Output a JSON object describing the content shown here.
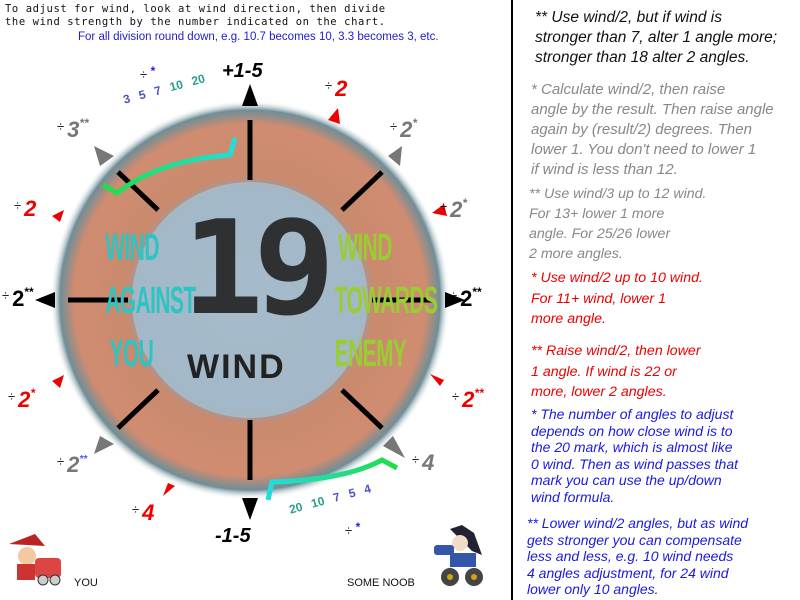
{
  "intro": {
    "line1": "To adjust for wind, look at wind direction, then divide\nthe wind strength by the number indicated on the chart.",
    "line2": "For all division round down, e.g. 10.7 becomes 10, 3.3 becomes 3, etc."
  },
  "dial": {
    "wind_value": "19",
    "wind_label": "WIND",
    "left_label": "WIND AGAINST YOU",
    "right_label": "WIND TOWARDS ENEMY",
    "top_label": "+1-5",
    "bottom_label": "-1-5",
    "upper_scale": [
      "3",
      "5",
      "7",
      "10",
      "20"
    ],
    "lower_scale": [
      "20",
      "10",
      "7",
      "5",
      "4"
    ],
    "divider_symbol": "÷",
    "markers": [
      {
        "position": "top-left-upper",
        "value": "",
        "mark": "*",
        "color": "#1a1ae0"
      },
      {
        "position": "top-left",
        "value": "3",
        "mark": "**",
        "color": "#777777"
      },
      {
        "position": "top-right-upper",
        "value": "2",
        "mark": "",
        "color": "#ee0000"
      },
      {
        "position": "top-right",
        "value": "2",
        "mark": "*",
        "color": "#777777"
      },
      {
        "position": "right-upper",
        "value": "2",
        "mark": "*",
        "color": "#777777"
      },
      {
        "position": "left-upper",
        "value": "2",
        "mark": "",
        "color": "#ee0000"
      },
      {
        "position": "left",
        "value": "2",
        "mark": "**",
        "color": "#000000"
      },
      {
        "position": "right",
        "value": "2",
        "mark": "**",
        "color": "#000000"
      },
      {
        "position": "left-lower",
        "value": "2",
        "mark": "*",
        "color": "#ee0000"
      },
      {
        "position": "right-lower",
        "value": "2",
        "mark": "**",
        "color": "#ee0000"
      },
      {
        "position": "bottom-left",
        "value": "2",
        "mark": "**",
        "color": "#777777"
      },
      {
        "position": "bottom-right",
        "value": "4",
        "mark": "",
        "color": "#777777"
      },
      {
        "position": "bottom-left-lower",
        "value": "4",
        "mark": "",
        "color": "#ee0000"
      },
      {
        "position": "bottom-right-lower",
        "value": "",
        "mark": "*",
        "color": "#1a1ae0"
      }
    ]
  },
  "players": {
    "you": "YOU",
    "enemy": "SOME NOOB"
  },
  "notes": [
    "** Use wind/2, but if wind is\nstronger than 7, alter 1 angle more;\nstronger than 18 alter 2 angles.",
    "* Calculate wind/2, then raise\nangle by the result. Then raise angle\nagain by (result/2) degrees. Then\nlower 1.  You don't need to lower 1\nif wind is less than 12.",
    "** Use wind/3 up to 12 wind.\n    For 13+ lower 1 more\n    angle.  For 25/26 lower\n    2 more angles.",
    "*  Use wind/2 up to 10 wind.\n    For 11+ wind, lower 1\n    more angle.",
    "** Raise wind/2, then lower\n    1 angle.  If wind is 22 or\n    more, lower 2 angles.",
    "*  The number of angles to adjust\ndepends on how close wind is to\nthe 20 mark, which is almost like\n0 wind.  Then as wind passes that\nmark you can use the up/down\nwind formula.",
    "** Lower wind/2 angles, but as wind\ngets stronger you can compensate\nless and less, e.g. 10 wind needs\n4 angles adjustment, for 24 wind\nlower only 10 angles."
  ],
  "colors": {
    "black_note": "#111111",
    "gray_note": "#888888",
    "red_note": "#ee0000",
    "blue_note": "#1a1ae0",
    "against_text": "#2ec4c4",
    "towards_text": "#9acd32"
  }
}
